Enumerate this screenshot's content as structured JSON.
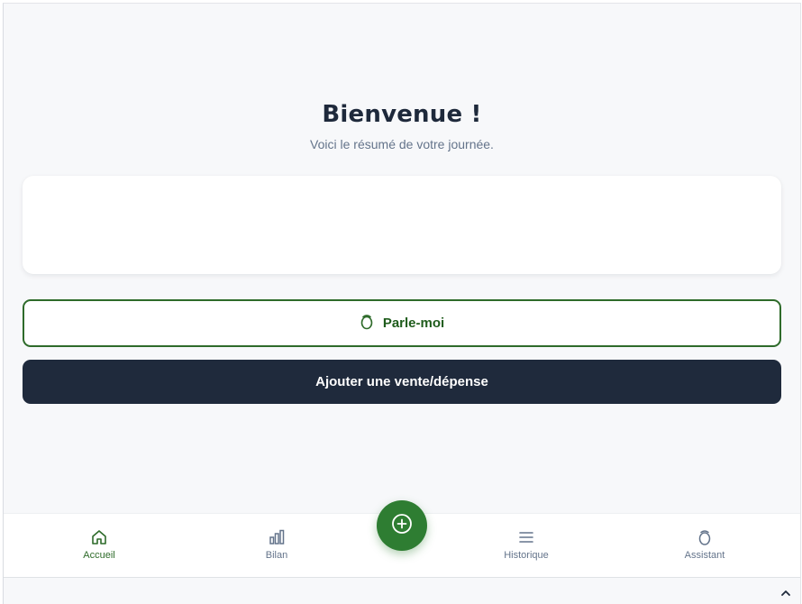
{
  "header": {
    "title": "Bienvenue !",
    "subtitle": "Voici le résumé de votre journée."
  },
  "actions": {
    "talk_label": "Parle-moi",
    "add_label": "Ajouter une vente/dépense"
  },
  "nav": {
    "items": [
      {
        "label": "Accueil",
        "icon": "home-icon",
        "active": true
      },
      {
        "label": "Bilan",
        "icon": "bar-chart-icon",
        "active": false
      },
      {
        "label": "Historique",
        "icon": "list-icon",
        "active": false
      },
      {
        "label": "Assistant",
        "icon": "assistant-icon",
        "active": false
      }
    ],
    "fab_icon": "plus-circle-icon"
  },
  "colors": {
    "accent": "#2e7d32",
    "dark": "#1f2a3c",
    "background": "#f7f8fa"
  }
}
